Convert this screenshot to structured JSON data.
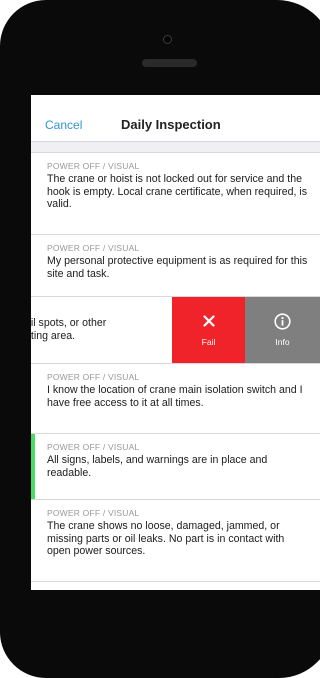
{
  "nav": {
    "cancel_label": "Cancel",
    "title": "Daily Inspection"
  },
  "items": [
    {
      "category": "POWER OFF / VISUAL",
      "text": "The crane or hoist is not locked out for service and the hook is empty. Local crane certificate, when required, is valid."
    },
    {
      "category": "POWER OFF / VISUAL",
      "text": "My personal protective equipment is as required for this site and task."
    },
    {
      "swiped_line_1": "oil spots, or other",
      "swiped_line_2": "ating area."
    },
    {
      "category": "POWER OFF / VISUAL",
      "text": "I know the location of crane main isolation switch and I have free access to it at all times."
    },
    {
      "category": "POWER OFF / VISUAL",
      "text": "All signs, labels, and warnings are in place and readable."
    },
    {
      "category": "POWER OFF / VISUAL",
      "text": "The crane shows no loose, damaged, jammed, or missing parts or oil leaks. No part is in contact with open power sources."
    }
  ],
  "actions": {
    "fail_label": "Fail",
    "info_label": "Info"
  },
  "colors": {
    "accent": "#2f95d6",
    "fail": "#f0232a",
    "info": "#7f7f7f",
    "passed_marker": "#4cd964"
  },
  "icons": {
    "fail": "close-x-icon",
    "info": "info-circle-icon"
  }
}
